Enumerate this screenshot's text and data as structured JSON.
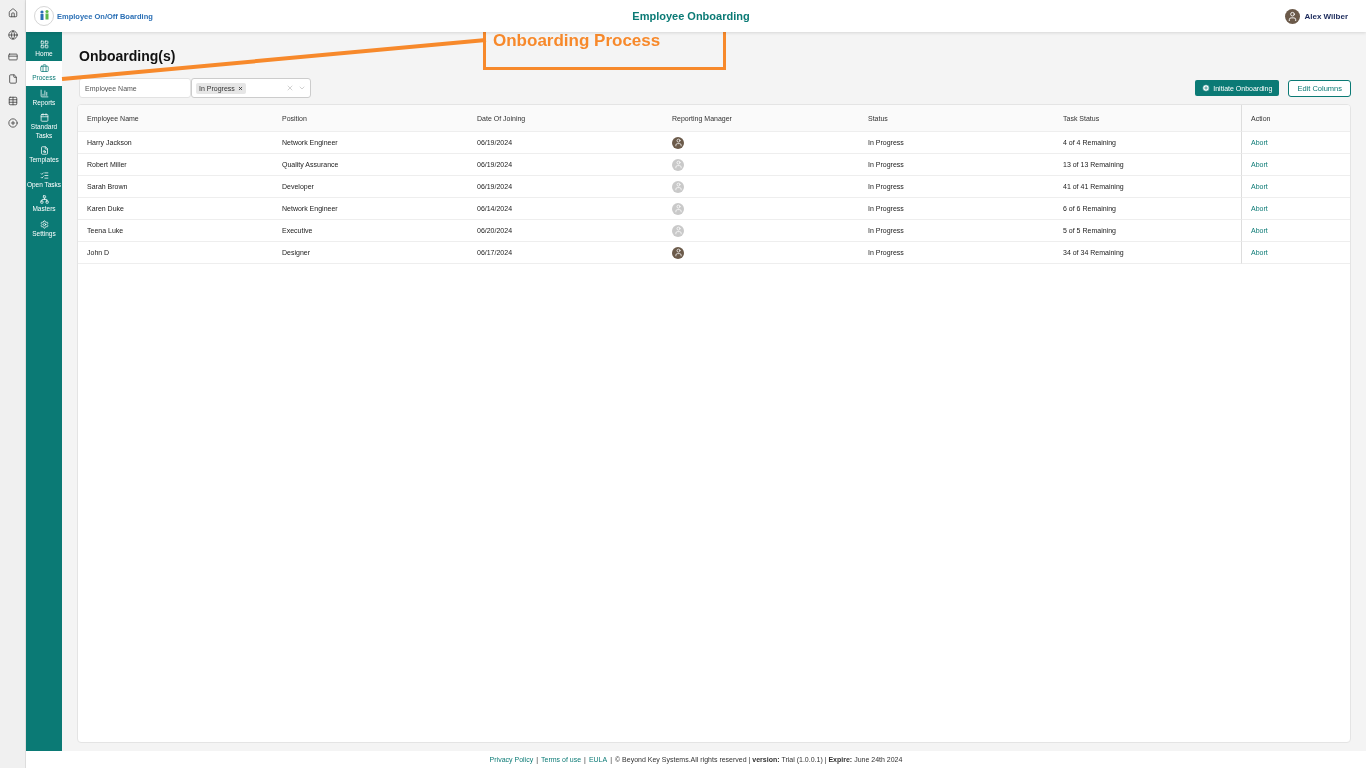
{
  "app": {
    "logo_text": "Employee On/Off Boarding",
    "title": "Employee Onboarding",
    "user": "Alex Wilber"
  },
  "rail": [
    {
      "kind": "home"
    },
    {
      "kind": "globe"
    },
    {
      "kind": "card"
    },
    {
      "kind": "file"
    },
    {
      "kind": "table"
    },
    {
      "kind": "add"
    }
  ],
  "sidebar": {
    "items": [
      {
        "label": "Home",
        "kind": "home",
        "selected": false
      },
      {
        "label": "Process",
        "kind": "process",
        "selected": true
      },
      {
        "label": "Reports",
        "kind": "reports",
        "selected": false
      },
      {
        "label": "Standard Tasks",
        "kind": "tasks",
        "selected": false
      },
      {
        "label": "Templates",
        "kind": "templates",
        "selected": false
      },
      {
        "label": "Open Tasks",
        "kind": "list",
        "selected": false
      },
      {
        "label": "Masters",
        "kind": "masters",
        "selected": false
      },
      {
        "label": "Settings",
        "kind": "settings",
        "selected": false
      }
    ]
  },
  "page_title": "Onboarding(s)",
  "filters": {
    "search": {
      "placeholder": "Employee Name"
    },
    "status_tags": [
      "In Progress"
    ]
  },
  "buttons": {
    "initiate": "Initiate Onboarding",
    "edit_columns": "Edit Columns"
  },
  "table": {
    "columns": [
      "Employee Name",
      "Position",
      "Date Of Joining",
      "Reporting Manager",
      "Status",
      "Task Status",
      "Action"
    ],
    "rows": [
      {
        "name": "Harry Jackson",
        "position": "Network Engineer",
        "date": "06/19/2024",
        "manager_has_photo": true,
        "status": "In Progress",
        "task_status": "4 of 4 Remaining",
        "action": "Abort"
      },
      {
        "name": "Robert Miller",
        "position": "Quality Assurance",
        "date": "06/19/2024",
        "manager_has_photo": false,
        "status": "In Progress",
        "task_status": "13 of 13 Remaining",
        "action": "Abort"
      },
      {
        "name": "Sarah Brown",
        "position": "Developer",
        "date": "06/19/2024",
        "manager_has_photo": false,
        "status": "In Progress",
        "task_status": "41 of 41 Remaining",
        "action": "Abort"
      },
      {
        "name": "Karen Duke",
        "position": "Network Engineer",
        "date": "06/14/2024",
        "manager_has_photo": false,
        "status": "In Progress",
        "task_status": "6 of 6 Remaining",
        "action": "Abort"
      },
      {
        "name": "Teena Luke",
        "position": "Executive",
        "date": "06/20/2024",
        "manager_has_photo": false,
        "status": "In Progress",
        "task_status": "5 of 5 Remaining",
        "action": "Abort"
      },
      {
        "name": "John D",
        "position": "Designer",
        "date": "06/17/2024",
        "manager_has_photo": true,
        "status": "In Progress",
        "task_status": "34 of 34 Remaining",
        "action": "Abort"
      }
    ]
  },
  "callout": {
    "label": "Onboarding Process"
  },
  "footer": [
    {
      "kind": "link",
      "text": "Privacy Policy"
    },
    {
      "kind": "separator",
      "text": "|"
    },
    {
      "kind": "link",
      "text": "Terms of use"
    },
    {
      "kind": "separator",
      "text": "|"
    },
    {
      "kind": "link",
      "text": "EULA"
    },
    {
      "kind": "separator",
      "text": "|"
    },
    {
      "kind": "text",
      "text": "© Beyond Key Systems.All rights reserved | **version:** Trial (1.0.0.1) | **Expire:** June 24th 2024"
    }
  ]
}
